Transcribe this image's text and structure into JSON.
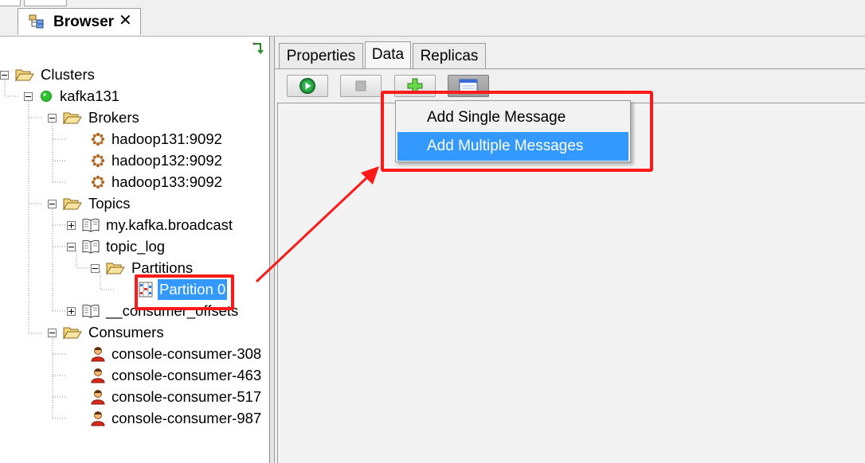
{
  "window": {
    "tab_title": "Browser",
    "tab_icon": "tree-view-icon",
    "tab_close": "✕"
  },
  "tree": {
    "nodes": [
      {
        "label": "Clusters",
        "icon": "folder-open-icon",
        "expander": "minus"
      },
      {
        "label": "kafka131",
        "icon": "green-status-dot-icon",
        "expander": "minus"
      },
      {
        "label": "Brokers",
        "icon": "folder-open-icon",
        "expander": "minus"
      },
      {
        "label": "hadoop131:9092",
        "icon": "broker-gear-icon",
        "expander": "none"
      },
      {
        "label": "hadoop132:9092",
        "icon": "broker-gear-icon",
        "expander": "none"
      },
      {
        "label": "hadoop133:9092",
        "icon": "broker-gear-icon",
        "expander": "none"
      },
      {
        "label": "Topics",
        "icon": "folder-open-icon",
        "expander": "minus"
      },
      {
        "label": "my.kafka.broadcast",
        "icon": "topic-book-icon",
        "expander": "plus"
      },
      {
        "label": "topic_log",
        "icon": "topic-book-icon",
        "expander": "minus"
      },
      {
        "label": "Partitions",
        "icon": "folder-open-icon",
        "expander": "minus"
      },
      {
        "label": "Partition 0",
        "icon": "partition-icon",
        "expander": "none",
        "selected": true
      },
      {
        "label": "__consumer_offsets",
        "icon": "topic-book-icon",
        "expander": "plus"
      },
      {
        "label": "Consumers",
        "icon": "folder-open-icon",
        "expander": "minus"
      },
      {
        "label": "console-consumer-308",
        "icon": "consumer-user-icon",
        "expander": "none"
      },
      {
        "label": "console-consumer-463",
        "icon": "consumer-user-icon",
        "expander": "none"
      },
      {
        "label": "console-consumer-517",
        "icon": "consumer-user-icon",
        "expander": "none"
      },
      {
        "label": "console-consumer-987",
        "icon": "consumer-user-icon",
        "expander": "none"
      }
    ]
  },
  "detail_tabs": [
    {
      "label": "Properties",
      "active": false
    },
    {
      "label": "Data",
      "active": true
    },
    {
      "label": "Replicas",
      "active": false
    }
  ],
  "toolbar": {
    "buttons": [
      {
        "name": "run-button",
        "icon": "play-icon",
        "enabled": true
      },
      {
        "name": "stop-button",
        "icon": "stop-icon",
        "enabled": false
      },
      {
        "name": "add-button",
        "icon": "plus-icon",
        "enabled": true
      },
      {
        "name": "view-button",
        "icon": "window-icon",
        "enabled": true,
        "pressed": true
      }
    ]
  },
  "add_menu": {
    "items": [
      {
        "label": "Add Single Message",
        "highlighted": false
      },
      {
        "label": "Add Multiple Messages",
        "highlighted": true
      }
    ]
  },
  "colors": {
    "selection": "#3399ff",
    "annotation": "#ff1a1a",
    "status_ok": "#2ec22e"
  }
}
